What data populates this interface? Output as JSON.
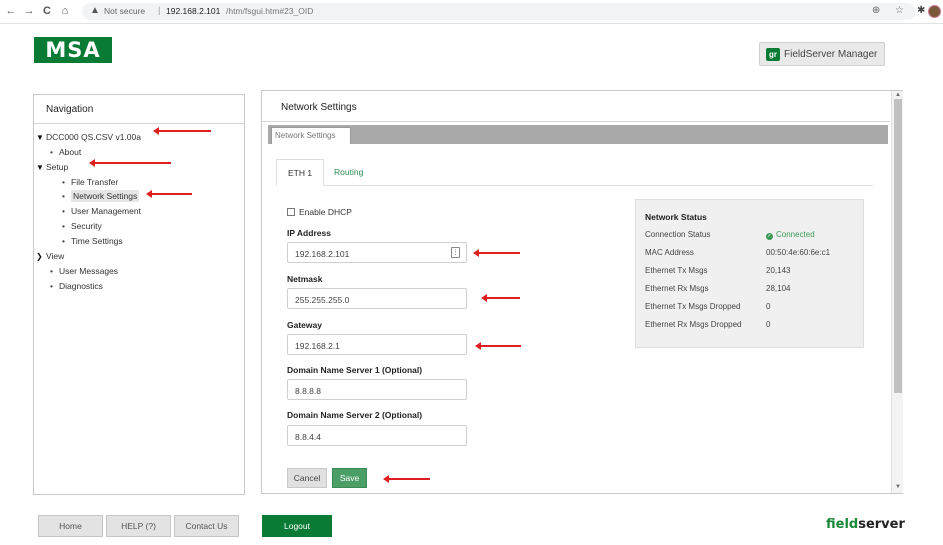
{
  "browser": {
    "back": "←",
    "forward": "→",
    "reload": "C",
    "home": "⌂",
    "warning_icon": "▲",
    "security_label": "Not secure",
    "separator": "|",
    "url_host": "192.168.2.101",
    "url_path": "/htm/fsgui.htm#23_OID",
    "omnibox_icons": "⊕ ☆",
    "ext_icon": "✱"
  },
  "header": {
    "logo_text": "MSA",
    "fs_manager_badge": "gr",
    "fs_manager_label": "FieldServer Manager"
  },
  "navigation": {
    "title": "Navigation",
    "items": [
      {
        "label": "DCC000 QS.CSV v1.00a",
        "marker": "✔"
      },
      {
        "label": "About",
        "marker": "•"
      },
      {
        "label": "Setup",
        "marker": "✔"
      },
      {
        "label": "File Transfer",
        "marker": "•"
      },
      {
        "label": "Network Settings",
        "marker": "•"
      },
      {
        "label": "User Management",
        "marker": "•"
      },
      {
        "label": "Security",
        "marker": "•"
      },
      {
        "label": "Time Settings",
        "marker": "•"
      },
      {
        "label": "View",
        "marker": "›"
      },
      {
        "label": "User Messages",
        "marker": "•"
      },
      {
        "label": "Diagnostics",
        "marker": "•"
      }
    ]
  },
  "main": {
    "title": "Network Settings",
    "tab_label": "Network Settings",
    "subtabs": [
      "ETH 1",
      "Routing"
    ],
    "enable_dhcp_label": "Enable DHCP",
    "fields": [
      {
        "label": "IP Address",
        "value": "192.168.2.101"
      },
      {
        "label": "Netmask",
        "value": "255.255.255.0"
      },
      {
        "label": "Gateway",
        "value": "192.168.2.1"
      },
      {
        "label": "Domain Name Server 1 (Optional)",
        "value": "8.8.8.8"
      },
      {
        "label": "Domain Name Server 2 (Optional)",
        "value": "8.8.4.4"
      }
    ],
    "cancel_label": "Cancel",
    "save_label": "Save",
    "network_status": {
      "title": "Network Status",
      "rows": [
        {
          "key": "Connection Status",
          "value": "Connected"
        },
        {
          "key": "MAC Address",
          "value": "00:50:4e:60:6e:c1"
        },
        {
          "key": "Ethernet Tx Msgs",
          "value": "20,143"
        },
        {
          "key": "Ethernet Rx Msgs",
          "value": "28,104"
        },
        {
          "key": "Ethernet Tx Msgs Dropped",
          "value": "0"
        },
        {
          "key": "Ethernet Rx Msgs Dropped",
          "value": "0"
        }
      ]
    }
  },
  "footer": {
    "home_label": "Home",
    "help_label": "HELP (?)",
    "contact_label": "Contact Us",
    "logout_label": "Logout",
    "brand_a": "field",
    "brand_b": "server"
  },
  "colors": {
    "brand_green": "#0a7b35",
    "save_green": "#4a9e66",
    "annotation_red": "#e02020",
    "connected_green": "#3b9a57"
  }
}
